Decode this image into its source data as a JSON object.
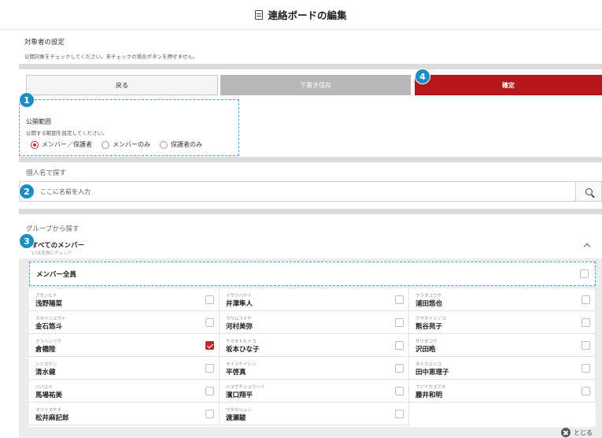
{
  "header": {
    "title": "連絡ボードの編集",
    "icon": "document-icon"
  },
  "target": {
    "title": "対象者の設定",
    "description": "公開対象をチェックしてください。未チェックの場合ボタンを押せません。"
  },
  "actions": {
    "back": "戻る",
    "draft": "下書き保存",
    "confirm": "確定",
    "confirm_color": "#b5161a"
  },
  "scope": {
    "title": "公開範囲",
    "description": "公開する範囲を設定してください。",
    "options": [
      "メンバー／保護者",
      "メンバーのみ",
      "保護者のみ"
    ],
    "selected": "メンバー／保護者"
  },
  "search": {
    "label": "個人名で探す",
    "placeholder": "ここに名前を入力"
  },
  "group": {
    "label": "グループから探す",
    "name": "すべてのメンバー",
    "sub": "17名全員にチェック",
    "all_label": "メンバー全員"
  },
  "badges": [
    "1",
    "2",
    "3",
    "4"
  ],
  "members": [
    [
      {
        "kana": "アサノヒナ",
        "name": "浅野陽菜",
        "checked": false
      },
      {
        "kana": "イサワハヤト",
        "name": "井澤隼人",
        "checked": false
      },
      {
        "kana": "ウラタユウヤ",
        "name": "浦田悠也",
        "checked": false
      }
    ],
    [
      {
        "kana": "カネイシユウト",
        "name": "金石悠斗",
        "checked": false
      },
      {
        "kana": "カワムラミヤ",
        "name": "河村美弥",
        "checked": false
      },
      {
        "kana": "クマガイソノコ",
        "name": "熊谷苑子",
        "checked": false
      }
    ],
    [
      {
        "kana": "クラハシリク",
        "name": "倉橋陸",
        "checked": true
      },
      {
        "kana": "サカモトヒナコ",
        "name": "坂本ひな子",
        "checked": false
      },
      {
        "kana": "サワダコウ",
        "name": "沢田晧",
        "checked": false
      }
    ],
    [
      {
        "kana": "シミズケン",
        "name": "清水健",
        "checked": false
      },
      {
        "kana": "タイラケイシン",
        "name": "平啓真",
        "checked": false
      },
      {
        "kana": "タナカエリコ",
        "name": "田中恵理子",
        "checked": false
      }
    ],
    [
      {
        "kana": "ババユミ",
        "name": "馬場祐美",
        "checked": false
      },
      {
        "kana": "ハマグチショウヘイ",
        "name": "濱口翔平",
        "checked": false
      },
      {
        "kana": "フジイカズアキ",
        "name": "藤井和明",
        "checked": false
      }
    ],
    [
      {
        "kana": "マツイマキオ",
        "name": "松井麻記郎",
        "checked": false
      },
      {
        "kana": "ワタセシュン",
        "name": "渡瀬駿",
        "checked": false
      }
    ]
  ],
  "close_label": "とじる"
}
